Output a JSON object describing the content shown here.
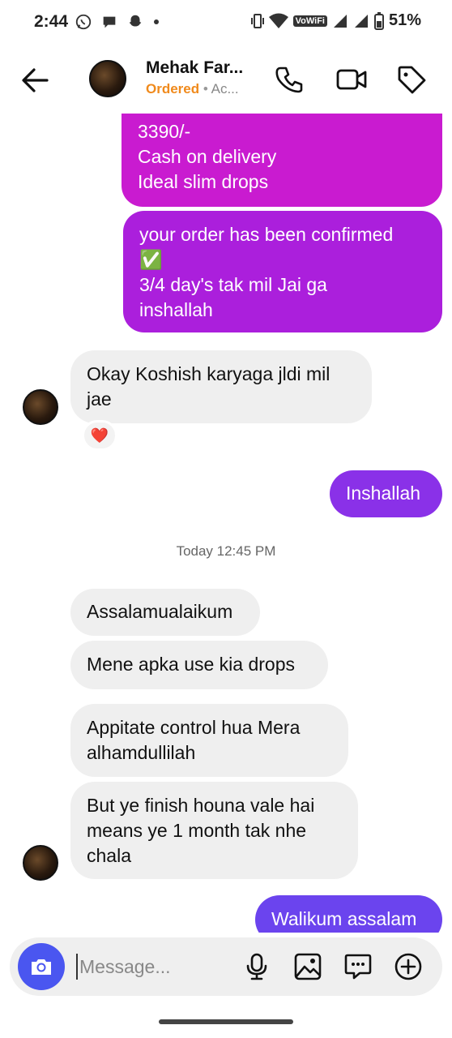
{
  "status_bar": {
    "time": "2:44",
    "network_label": "VoWiFi",
    "battery": "51%"
  },
  "header": {
    "contact_name": "Mehak Far...",
    "order_status": "Ordered",
    "separator": "•",
    "activity": "Ac...",
    "icons": [
      "back-arrow-icon",
      "phone-icon",
      "video-camera-icon",
      "tag-icon"
    ]
  },
  "messages": [
    {
      "direction": "outgoing",
      "text": "3390/-\nCash on delivery\nIdeal slim drops"
    },
    {
      "direction": "outgoing",
      "text": "your order has been confirmed\n✅\n3/4 day's tak mil Jai ga\ninshallah"
    },
    {
      "direction": "incoming",
      "text": "Okay Koshish karyaga jldi mil\njae",
      "reaction": "❤️"
    },
    {
      "direction": "outgoing",
      "text": "Inshallah"
    },
    {
      "direction": "incoming",
      "text": "Assalamualaikum"
    },
    {
      "direction": "incoming",
      "text": "Mene apka use kia drops"
    },
    {
      "direction": "incoming",
      "text": "Appitate control hua Mera\nalhamdullilah"
    },
    {
      "direction": "incoming",
      "text": "But ye finish houna vale hai\nmeans ye 1 month tak nhe\nchala"
    },
    {
      "direction": "outgoing",
      "text": "Walikum assalam"
    }
  ],
  "timestamp": "Today 12:45 PM",
  "composer": {
    "placeholder": "Message...",
    "value": "",
    "icons": [
      "camera-icon",
      "microphone-icon",
      "image-icon",
      "chat-bubble-icon",
      "plus-circle-icon"
    ]
  },
  "colors": {
    "accent_orange": "#f08a1c",
    "outgoing_magenta": "#c91bd0",
    "outgoing_purple": "#ab1fdc",
    "outgoing_violet": "#8a31e8",
    "outgoing_blue": "#6b44ee",
    "incoming_gray": "#efefef",
    "camera_button": "#4a56f0"
  }
}
